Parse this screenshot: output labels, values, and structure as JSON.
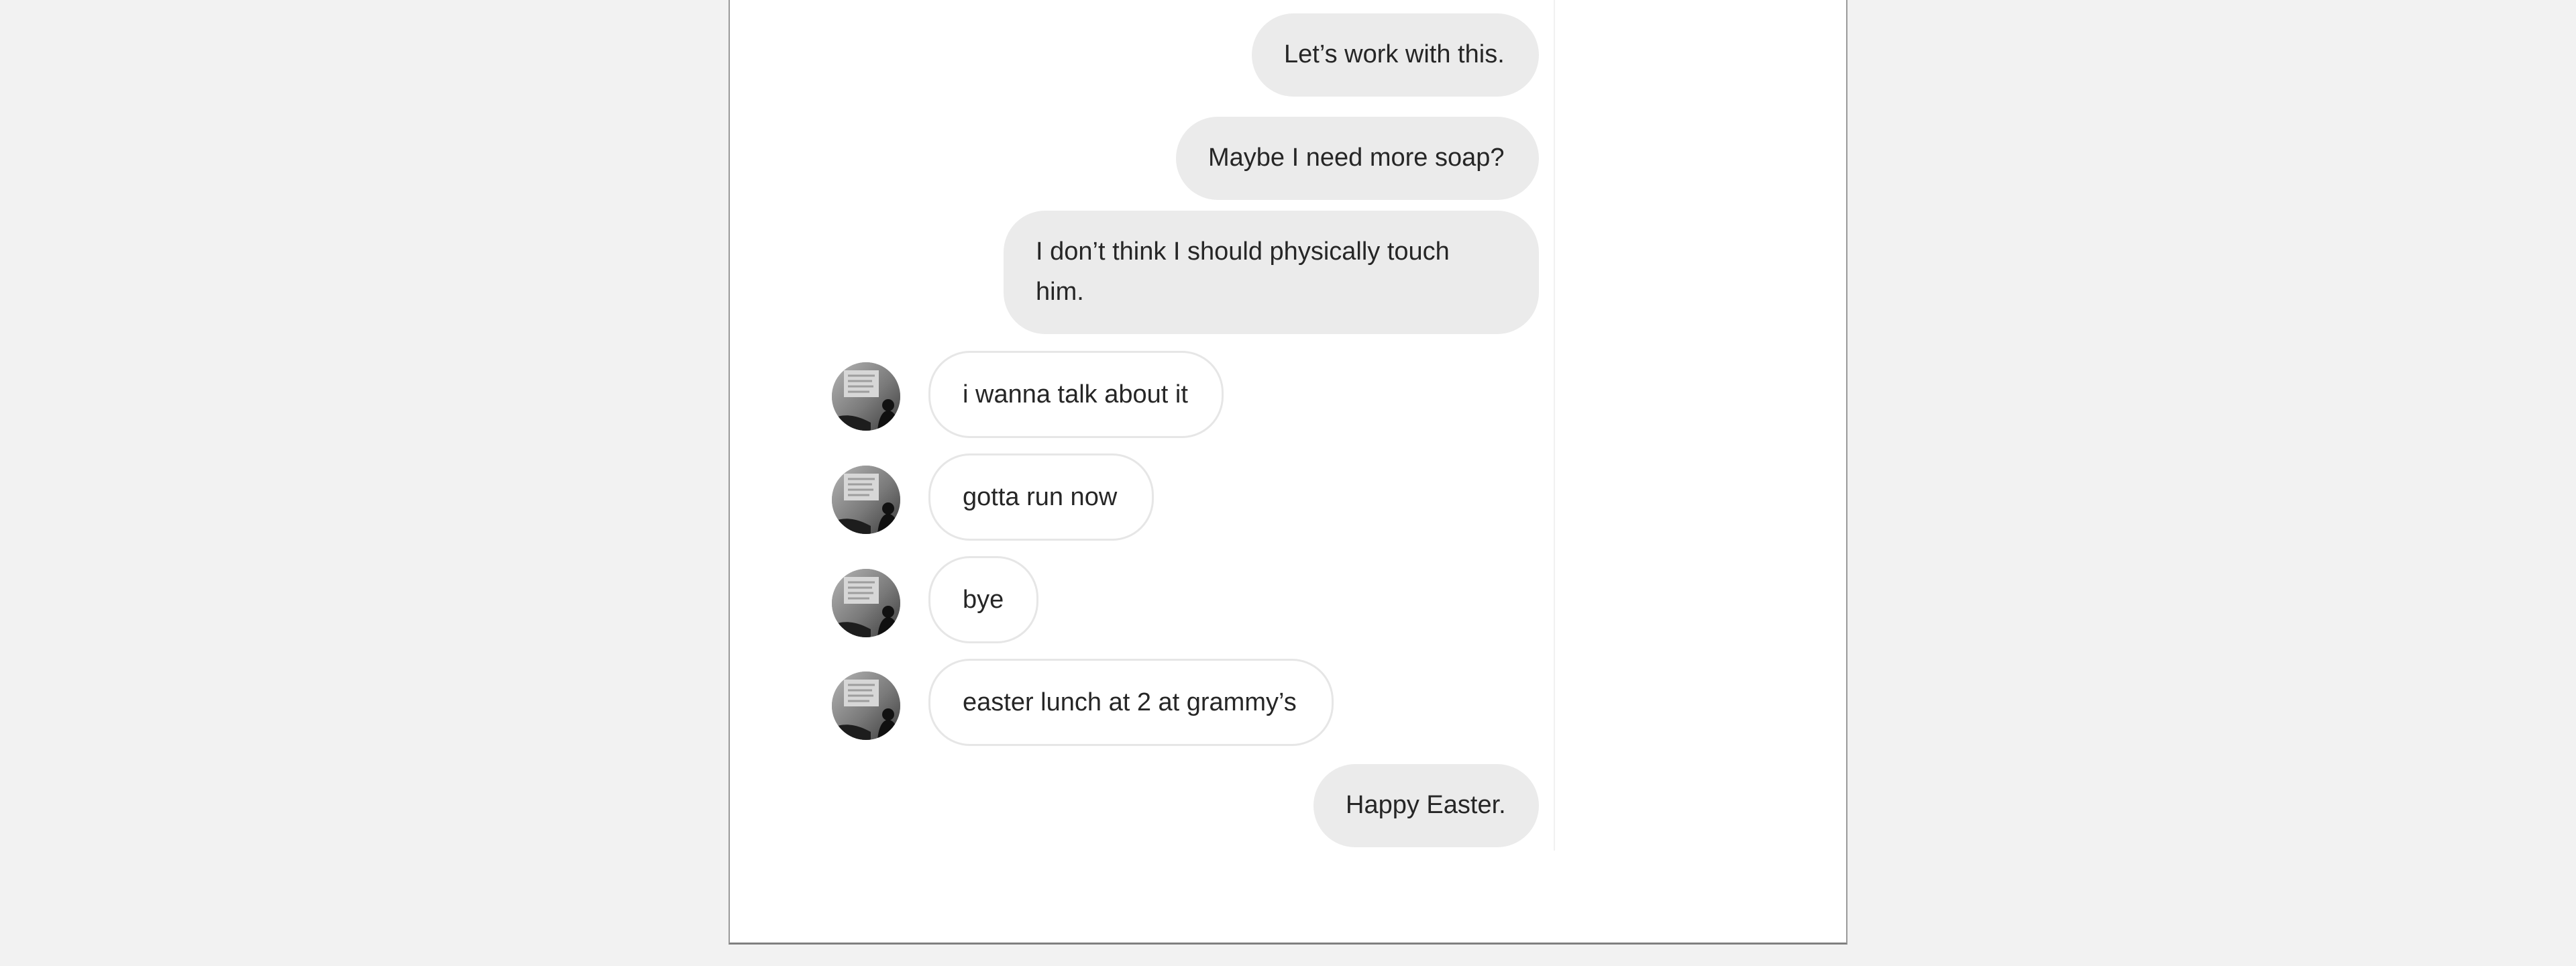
{
  "conversation": {
    "messages": [
      {
        "sender": "me",
        "text": "Let’s work with this."
      },
      {
        "sender": "me",
        "text": "Maybe I need more soap?"
      },
      {
        "sender": "me",
        "text": "I don’t think I should physically touch him."
      },
      {
        "sender": "contact",
        "text": "i wanna talk about it"
      },
      {
        "sender": "contact",
        "text": "gotta run now"
      },
      {
        "sender": "contact",
        "text": "bye"
      },
      {
        "sender": "contact",
        "text": "easter lunch at 2 at grammy’s"
      },
      {
        "sender": "me",
        "text": "Happy Easter."
      }
    ]
  },
  "colors": {
    "sent_bubble": "#ebebeb",
    "received_bubble": "#ffffff",
    "received_border": "#e6e6e6",
    "text": "#262626",
    "page_background": "#f2f2f2"
  },
  "icons": {
    "avatar": "contact-avatar-grayscale-photo"
  }
}
